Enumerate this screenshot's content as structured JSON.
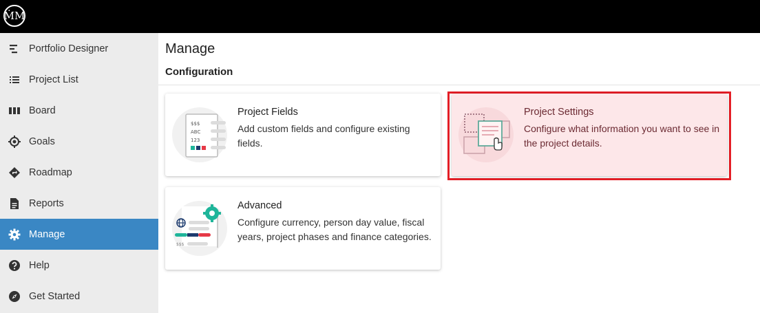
{
  "app": {
    "logo_text": "ṀM",
    "logo_icon": "crown-m-logo"
  },
  "colors": {
    "accent": "#3a87c4",
    "highlight_border": "#e41e26",
    "highlight_fill": "#fde7e9",
    "teal": "#1fb59a",
    "navy": "#1d3b6e",
    "red": "#e63946"
  },
  "sidebar": {
    "items": [
      {
        "label": "Portfolio Designer",
        "icon": "portfolio-designer-icon",
        "active": false
      },
      {
        "label": "Project List",
        "icon": "list-icon",
        "active": false
      },
      {
        "label": "Board",
        "icon": "board-icon",
        "active": false
      },
      {
        "label": "Goals",
        "icon": "target-icon",
        "active": false
      },
      {
        "label": "Roadmap",
        "icon": "roadmap-icon",
        "active": false
      },
      {
        "label": "Reports",
        "icon": "document-icon",
        "active": false
      },
      {
        "label": "Manage",
        "icon": "gear-icon",
        "active": true
      },
      {
        "label": "Help",
        "icon": "help-icon",
        "active": false
      },
      {
        "label": "Get Started",
        "icon": "compass-icon",
        "active": false
      }
    ]
  },
  "main": {
    "title": "Manage",
    "section": "Configuration",
    "cards": [
      {
        "title": "Project Fields",
        "description": "Add custom fields and configure existing fields.",
        "illustration": {
          "lines": [
            "$$$",
            "ABC",
            "123"
          ]
        }
      },
      {
        "title": "Project Settings",
        "description": "Configure what information you want to see in the project details.",
        "highlighted": true
      },
      {
        "title": "Advanced",
        "description": "Configure currency, person day value, fiscal years, project phases and finance categories.",
        "illustration": {
          "currency": "$$$"
        }
      }
    ]
  }
}
